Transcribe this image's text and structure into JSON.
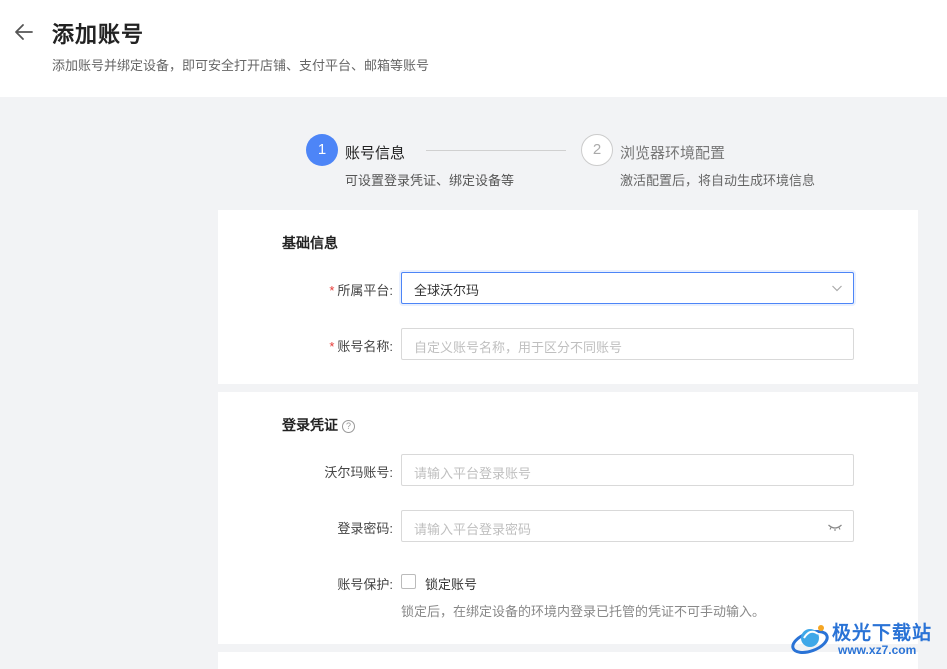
{
  "header": {
    "title": "添加账号",
    "subtitle": "添加账号并绑定设备，即可安全打开店铺、支付平台、邮箱等账号"
  },
  "steps": [
    {
      "number": "1",
      "title": "账号信息",
      "desc": "可设置登录凭证、绑定设备等",
      "state": "active"
    },
    {
      "number": "2",
      "title": "浏览器环境配置",
      "desc": "激活配置后，将自动生成环境信息",
      "state": "pending"
    }
  ],
  "basic_info": {
    "section_title": "基础信息",
    "platform_label": "所属平台:",
    "platform_value": "全球沃尔玛",
    "name_label": "账号名称:",
    "name_placeholder": "自定义账号名称，用于区分不同账号"
  },
  "credentials": {
    "section_title": "登录凭证",
    "help_icon": "?",
    "account_label": "沃尔玛账号:",
    "account_placeholder": "请输入平台登录账号",
    "password_label": "登录密码:",
    "password_placeholder": "请输入平台登录密码",
    "protect_label": "账号保护:",
    "lock_label": "锁定账号",
    "lock_hint": "锁定后，在绑定设备的环境内登录已托管的凭证不可手动输入。"
  },
  "watermark": {
    "text1": "极光下载站",
    "text2": "www.xz7.com"
  },
  "icons": {
    "back": "arrow-left-icon",
    "dropdown": "chevron-down-icon",
    "password_toggle": "eye-closed-icon",
    "help": "question-circle-icon"
  },
  "colors": {
    "accent": "#4d85f7",
    "required": "#e53935",
    "background": "#f2f3f5"
  },
  "required_mark": "*"
}
